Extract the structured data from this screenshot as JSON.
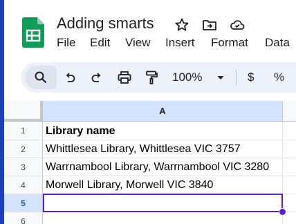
{
  "app": {
    "document_title": "Adding smarts",
    "logo_icon": "google-sheets-logo",
    "title_icons": [
      "star-icon",
      "move-to-folder-icon",
      "cloud-saved-icon"
    ]
  },
  "menu": {
    "items": [
      "File",
      "Edit",
      "View",
      "Insert",
      "Format",
      "Data"
    ]
  },
  "toolbar": {
    "icons": [
      "search-icon",
      "undo-icon",
      "redo-icon",
      "print-icon",
      "paint-format-icon"
    ],
    "zoom": "100%",
    "currency_label": "$",
    "percent_label": "%"
  },
  "sheet": {
    "columns": [
      "A"
    ],
    "selected_cell": "A5",
    "rows": [
      {
        "number": "1",
        "value": "Library name"
      },
      {
        "number": "2",
        "value": "Whittlesea Library, Whittlesea VIC 3757"
      },
      {
        "number": "3",
        "value": "Warrnambool Library, Warrnambool VIC 3280"
      },
      {
        "number": "4",
        "value": "Morwell Library, Morwell VIC 3840"
      },
      {
        "number": "5",
        "value": ""
      },
      {
        "number": "6",
        "value": ""
      }
    ]
  },
  "colors": {
    "sheets_green": "#0f9d58",
    "selection": "#5b1fc9",
    "header_highlight": "#d3e3fd",
    "toolbar_bg": "#edf2fa"
  }
}
